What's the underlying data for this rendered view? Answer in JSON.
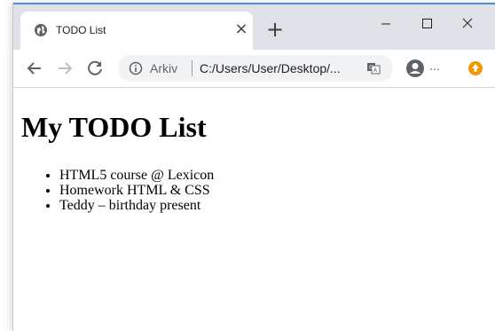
{
  "browser": {
    "tab": {
      "title": "TODO List",
      "close_glyph": "×",
      "favicon": "globe-icon"
    },
    "new_tab_glyph": "+",
    "window_controls": {
      "minimize_glyph": "–",
      "maximize_glyph": "☐",
      "close_glyph": "✕"
    },
    "toolbar": {
      "back_icon": "arrow-left-icon",
      "forward_icon": "arrow-right-icon",
      "reload_icon": "reload-icon",
      "omnibox": {
        "info_icon": "info-icon",
        "site_label": "Arkiv",
        "url": "C:/Users/User/Desktop/...",
        "translate_icon": "translate-icon"
      },
      "profile_icon": "profile-icon",
      "more_label": "...",
      "extension_icon": "extension-icon"
    },
    "colors": {
      "tabstrip": "#dee1e6",
      "accent": "#4a90d9",
      "extension": "#f29900"
    }
  },
  "page": {
    "heading": "My TODO List",
    "items": [
      "HTML5 course @ Lexicon",
      "Homework HTML & CSS",
      "Teddy – birthday present"
    ]
  }
}
